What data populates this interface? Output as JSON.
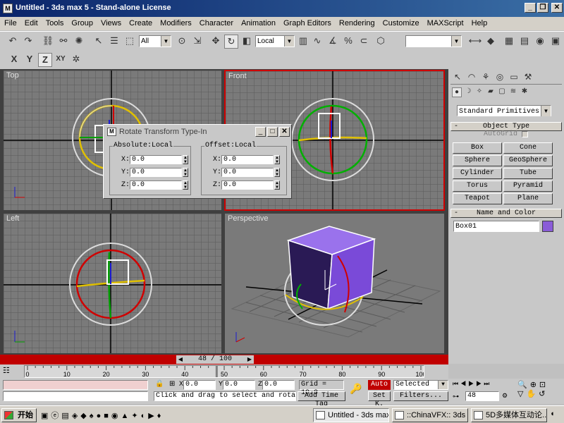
{
  "window": {
    "title": "Untitled - 3ds max 5 - Stand-alone License",
    "icon": "3dsmax-app-icon"
  },
  "menu": [
    "File",
    "Edit",
    "Tools",
    "Group",
    "Views",
    "Create",
    "Modifiers",
    "Character",
    "Animation",
    "Graph Editors",
    "Rendering",
    "Customize",
    "MAXScript",
    "Help"
  ],
  "toolbar": {
    "selection_filter": "All",
    "ref_coord": "Local",
    "named_selection": ""
  },
  "axis_constraints": {
    "x": "X",
    "y": "Y",
    "z": "Z",
    "xy": "XY"
  },
  "viewports": {
    "top": "Top",
    "front": "Front",
    "left": "Left",
    "perspective": "Perspective"
  },
  "dialog": {
    "title": "Rotate Transform Type-In",
    "absolute_label": "Absolute:Local",
    "offset_label": "Offset:Local",
    "absolute": {
      "x": "0.0",
      "y": "0.0",
      "z": "0.0"
    },
    "offset": {
      "x": "0.0",
      "y": "0.0",
      "z": "0.0"
    },
    "x_label": "X:",
    "y_label": "Y:",
    "z_label": "Z:"
  },
  "command_panel": {
    "category": "Standard Primitives",
    "object_type_header": "Object Type",
    "autogrid": "AutoGrid",
    "buttons": [
      "Box",
      "Cone",
      "Sphere",
      "GeoSphere",
      "Cylinder",
      "Tube",
      "Torus",
      "Pyramid",
      "Teapot",
      "Plane"
    ],
    "name_color_header": "Name and Color",
    "object_name": "Box01",
    "object_color": "#8a5cd8"
  },
  "timeline": {
    "frame_display": "48 / 100",
    "current_frame": 48,
    "total_frames": 100,
    "ticks": [
      "0",
      "10",
      "20",
      "30",
      "40",
      "50",
      "60",
      "70",
      "80",
      "90",
      "100"
    ]
  },
  "status": {
    "x_label": "X",
    "y_label": "Y",
    "z_label": "Z",
    "x_value": "0.0",
    "y_value": "0.0",
    "z_value": "0.0",
    "grid": "Grid = 10.0",
    "prompt": "Click and drag to select and rotate objec",
    "add_time_tag": "Add Time Tag",
    "auto_key": "Auto",
    "set_key": "Set K.",
    "key_filter": "Selected",
    "filters": "Filters...",
    "frame_field": "48"
  },
  "taskbar": {
    "start": "开始",
    "tasks": [
      "Untitled - 3ds max...",
      "::ChinaVFX:: 3ds ...",
      "5D多媒体互动论..."
    ]
  },
  "colors": {
    "viewport_bg": "#7a7a7a",
    "active_border": "#d00000",
    "time_slider": "#c00000",
    "title_gradient_start": "#0a246a"
  }
}
